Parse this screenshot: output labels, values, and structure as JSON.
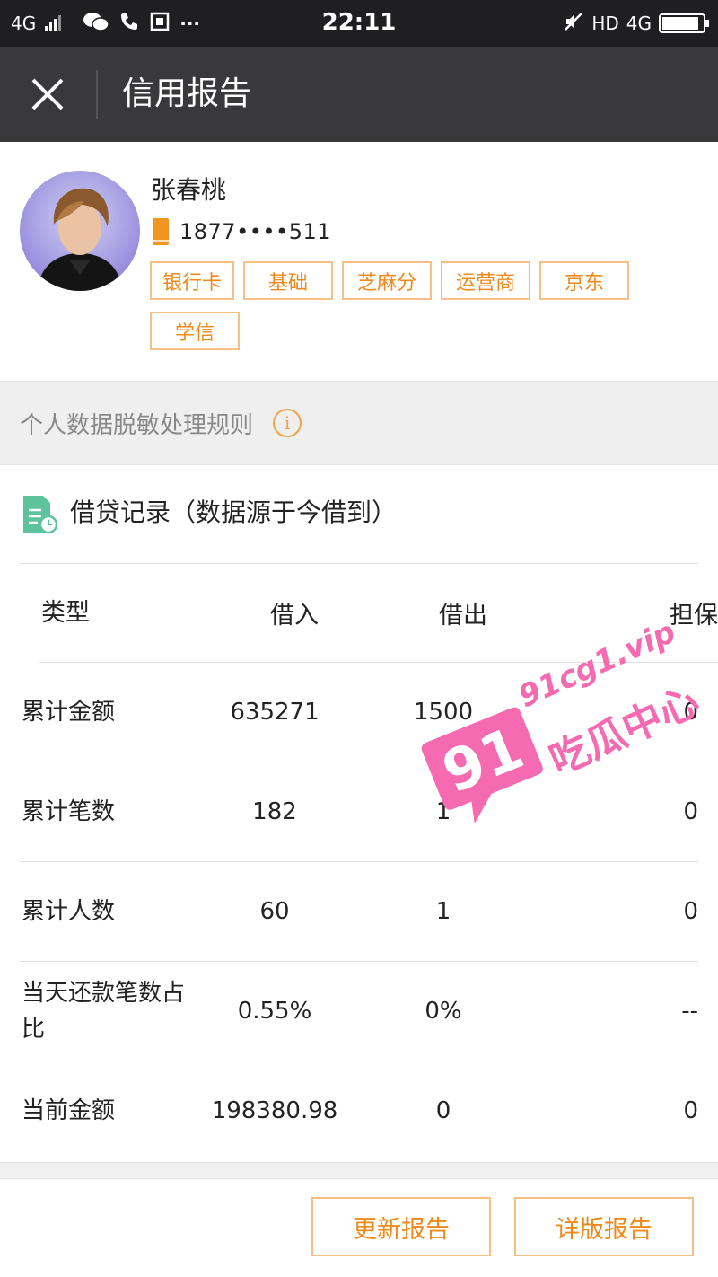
{
  "status_bar": {
    "network": "4G",
    "time": "22:11",
    "hd": "HD",
    "network_right": "4G",
    "dots": "···"
  },
  "header": {
    "title": "信用报告"
  },
  "profile": {
    "name": "张春桃",
    "phone": "1877••••511",
    "tags": [
      "银行卡",
      "基础",
      "芝麻分",
      "运营商",
      "京东",
      "学信"
    ]
  },
  "rules": {
    "label": "个人数据脱敏处理规则",
    "info_glyph": "i"
  },
  "section": {
    "title": "借贷记录（数据源于今借到）"
  },
  "table": {
    "headers": [
      "类型",
      "借入",
      "借出",
      "担保"
    ],
    "rows": [
      {
        "label": "累计金额",
        "borrow_in": "635271",
        "borrow_out": "1500",
        "guarantee": "0"
      },
      {
        "label": "累计笔数",
        "borrow_in": "182",
        "borrow_out": "1",
        "guarantee": "0"
      },
      {
        "label": "累计人数",
        "borrow_in": "60",
        "borrow_out": "1",
        "guarantee": "0"
      },
      {
        "label": "当天还款笔数占比",
        "borrow_in": "0.55%",
        "borrow_out": "0%",
        "guarantee": "--"
      },
      {
        "label": "当前金额",
        "borrow_in": "198380.98",
        "borrow_out": "0",
        "guarantee": "0"
      }
    ]
  },
  "footer": {
    "refresh_label": "更新报告",
    "detail_label": "详版报告"
  },
  "watermark": {
    "badge": "91",
    "url": "91cg1.vip",
    "name": "吃瓜中心"
  },
  "colors": {
    "status_bar": "#1f1f21",
    "title_bar": "#39393b",
    "accent": "#ee8a1c",
    "accent_border": "#f5c087",
    "band": "#efefef",
    "watermark": "#f56ab0",
    "doc_icon": "#5cc39a"
  }
}
